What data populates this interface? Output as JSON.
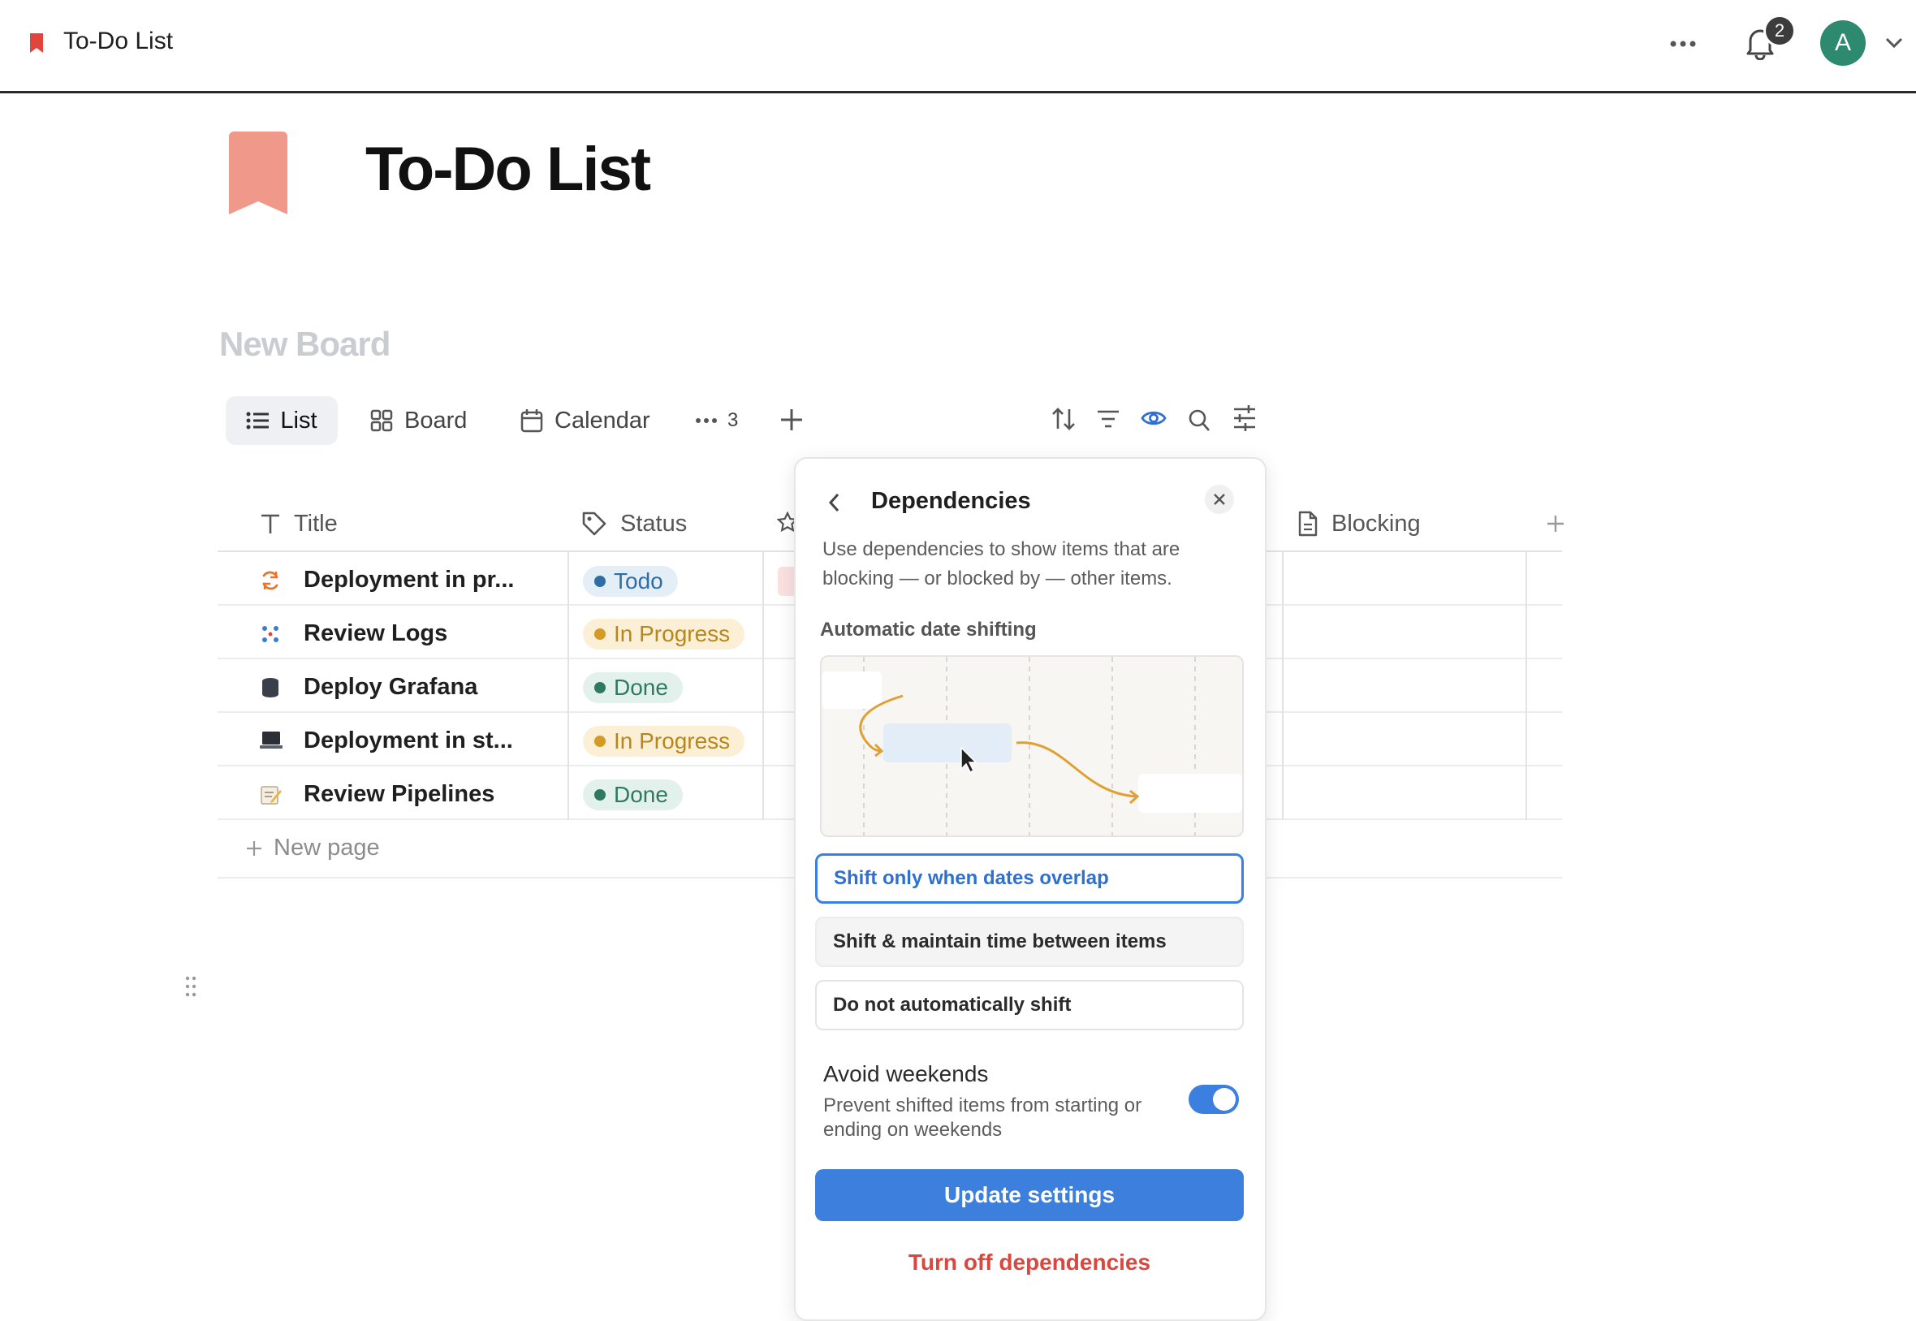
{
  "topbar": {
    "title": "To-Do List",
    "notification_count": "2",
    "avatar_letter": "A"
  },
  "page": {
    "title": "To-Do List",
    "board_title": "New Board",
    "icon_color": "#f0998a"
  },
  "views": {
    "tabs": [
      {
        "label": "List",
        "active": true
      },
      {
        "label": "Board",
        "active": false
      },
      {
        "label": "Calendar",
        "active": false
      }
    ],
    "more_count": "3"
  },
  "table": {
    "columns": [
      "Title",
      "Status",
      "Blocking"
    ],
    "rows": [
      {
        "title": "Deployment in pr...",
        "status": "Todo",
        "icon": "sync-icon"
      },
      {
        "title": "Review Logs",
        "status": "In Progress",
        "icon": "dots-grid-icon"
      },
      {
        "title": "Deploy Grafana",
        "status": "Done",
        "icon": "database-icon"
      },
      {
        "title": "Deployment in st...",
        "status": "In Progress",
        "icon": "laptop-icon"
      },
      {
        "title": "Review Pipelines",
        "status": "Done",
        "icon": "memo-icon"
      }
    ],
    "new_page_label": "New page"
  },
  "status_colors": {
    "Todo": {
      "bg": "#e4eef7",
      "fg": "#2e6ea6",
      "dot": "#2e6ea6"
    },
    "In Progress": {
      "bg": "#fbf0d6",
      "fg": "#b7861d",
      "dot": "#d39a25"
    },
    "Done": {
      "bg": "#e3f1ec",
      "fg": "#2d7a5f",
      "dot": "#2d7a5f"
    }
  },
  "popover": {
    "title": "Dependencies",
    "description": "Use dependencies to show items that are blocking — or blocked by — other items.",
    "subheading": "Automatic date shifting",
    "options": [
      {
        "label": "Shift only when dates overlap",
        "selected": true
      },
      {
        "label": "Shift & maintain time between items",
        "selected": false
      },
      {
        "label": "Do not automatically shift",
        "selected": false
      }
    ],
    "avoid_weekends": {
      "title": "Avoid weekends",
      "description": "Prevent shifted items from starting or ending on weekends",
      "enabled": true
    },
    "update_button": "Update settings",
    "turn_off_button": "Turn off dependencies"
  }
}
